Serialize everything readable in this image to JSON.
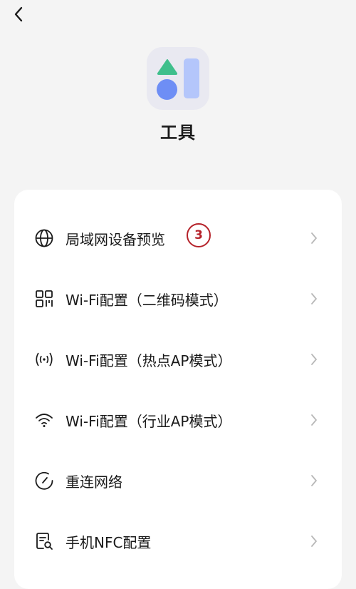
{
  "header": {
    "back_icon": "chevron-left-icon",
    "title": "工具"
  },
  "app_icon": {
    "name": "tools-app-icon",
    "colors": {
      "background": "#e9e9f1",
      "triangle": "#3fbf8c",
      "circle": "#6e8ef5",
      "bar": "#b4c6fb"
    }
  },
  "menu": {
    "items": [
      {
        "icon": "globe-icon",
        "label": "局域网设备预览"
      },
      {
        "icon": "qr-code-icon",
        "label": "Wi-Fi配置（二维码模式）"
      },
      {
        "icon": "hotspot-icon",
        "label": "Wi-Fi配置（热点AP模式）"
      },
      {
        "icon": "wifi-icon",
        "label": "Wi-Fi配置（行业AP模式）"
      },
      {
        "icon": "reconnect-icon",
        "label": "重连网络"
      },
      {
        "icon": "nfc-search-icon",
        "label": "手机NFC配置"
      }
    ]
  },
  "annotation": {
    "text": "3",
    "color": "#b5222a"
  }
}
